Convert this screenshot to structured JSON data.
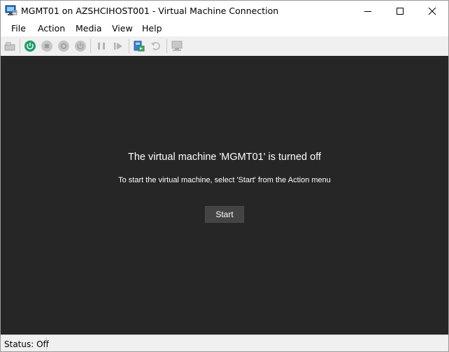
{
  "window": {
    "title": "MGMT01 on AZSHCIHOST001 - Virtual Machine Connection"
  },
  "menu": {
    "items": [
      {
        "label": "File"
      },
      {
        "label": "Action"
      },
      {
        "label": "Media"
      },
      {
        "label": "View"
      },
      {
        "label": "Help"
      }
    ]
  },
  "toolbar": {
    "icons": [
      "ctrl-alt-del-icon",
      "start-icon",
      "turn-off-icon",
      "shut-down-icon",
      "save-icon",
      "pause-icon",
      "resume-icon",
      "checkpoint-icon",
      "revert-icon",
      "enhanced-session-icon"
    ]
  },
  "screen": {
    "message": "The virtual machine 'MGMT01' is turned off",
    "hint": "To start the virtual machine, select 'Start' from the Action menu",
    "start_label": "Start",
    "background": "#262626"
  },
  "status": {
    "text": "Status: Off"
  },
  "colors": {
    "start_green": "#1e9e6a",
    "screen_bg": "#262626",
    "button_bg": "#444444"
  }
}
